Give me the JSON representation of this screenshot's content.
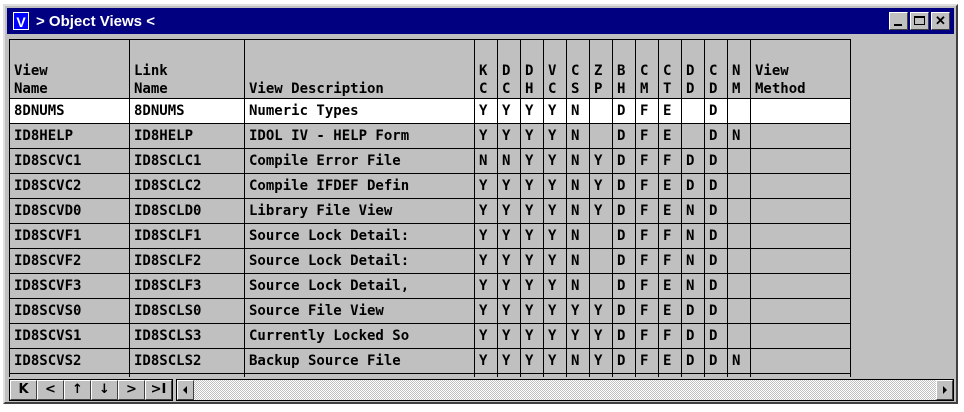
{
  "window": {
    "icon_letter": "V",
    "title": "> Object Views <",
    "buttons": {
      "minimize": "minimize",
      "maximize": "maximize",
      "close": "✕"
    }
  },
  "table": {
    "headers": [
      [
        "View",
        "Name"
      ],
      [
        "Link",
        "Name"
      ],
      [
        "",
        "View Description"
      ],
      [
        "K",
        "C"
      ],
      [
        "D",
        "C"
      ],
      [
        "D",
        "H"
      ],
      [
        "V",
        "C"
      ],
      [
        "C",
        "S"
      ],
      [
        "Z",
        "P"
      ],
      [
        "B",
        "H"
      ],
      [
        "C",
        "M"
      ],
      [
        "C",
        "T"
      ],
      [
        "D",
        "D"
      ],
      [
        "C",
        "D"
      ],
      [
        "N",
        "M"
      ],
      [
        "View",
        "Method"
      ]
    ],
    "rows": [
      [
        "8DNUMS",
        "8DNUMS",
        "Numeric Types",
        "Y",
        "Y",
        "Y",
        "Y",
        "N",
        "",
        "D",
        "F",
        "E",
        "",
        "D",
        "",
        ""
      ],
      [
        "ID8HELP",
        "ID8HELP",
        "IDOL IV - HELP Form",
        "Y",
        "Y",
        "Y",
        "Y",
        "N",
        "",
        "D",
        "F",
        "E",
        "",
        "D",
        "N",
        ""
      ],
      [
        "ID8SCVC1",
        "ID8SCLC1",
        "Compile Error File",
        "N",
        "N",
        "Y",
        "Y",
        "N",
        "Y",
        "D",
        "F",
        "F",
        "D",
        "D",
        "",
        ""
      ],
      [
        "ID8SCVC2",
        "ID8SCLC2",
        "Compile IFDEF Defin",
        "Y",
        "Y",
        "Y",
        "Y",
        "N",
        "Y",
        "D",
        "F",
        "E",
        "D",
        "D",
        "",
        ""
      ],
      [
        "ID8SCVD0",
        "ID8SCLD0",
        "Library File View",
        "Y",
        "Y",
        "Y",
        "Y",
        "N",
        "Y",
        "D",
        "F",
        "E",
        "N",
        "D",
        "",
        ""
      ],
      [
        "ID8SCVF1",
        "ID8SCLF1",
        "Source Lock Detail:",
        "Y",
        "Y",
        "Y",
        "Y",
        "N",
        "",
        "D",
        "F",
        "F",
        "N",
        "D",
        "",
        ""
      ],
      [
        "ID8SCVF2",
        "ID8SCLF2",
        "Source Lock Detail:",
        "Y",
        "Y",
        "Y",
        "Y",
        "N",
        "",
        "D",
        "F",
        "F",
        "N",
        "D",
        "",
        ""
      ],
      [
        "ID8SCVF3",
        "ID8SCLF3",
        "Source Lock Detail,",
        "Y",
        "Y",
        "Y",
        "Y",
        "N",
        "",
        "D",
        "F",
        "E",
        "N",
        "D",
        "",
        ""
      ],
      [
        "ID8SCVS0",
        "ID8SCLS0",
        "Source File View",
        "Y",
        "Y",
        "Y",
        "Y",
        "Y",
        "Y",
        "D",
        "F",
        "E",
        "D",
        "D",
        "",
        ""
      ],
      [
        "ID8SCVS1",
        "ID8SCLS3",
        "Currently Locked So",
        "Y",
        "Y",
        "Y",
        "Y",
        "Y",
        "Y",
        "D",
        "F",
        "F",
        "D",
        "D",
        "",
        ""
      ],
      [
        "ID8SCVS2",
        "ID8SCLS2",
        "Backup Source File",
        "Y",
        "Y",
        "Y",
        "Y",
        "N",
        "Y",
        "D",
        "F",
        "E",
        "D",
        "D",
        "N",
        ""
      ]
    ]
  },
  "nav_buttons": [
    "K",
    "<",
    "↑",
    "↓",
    ">",
    ">I"
  ],
  "scrollbar": {
    "left_arrow": "scroll-left",
    "right_arrow": "scroll-right"
  }
}
